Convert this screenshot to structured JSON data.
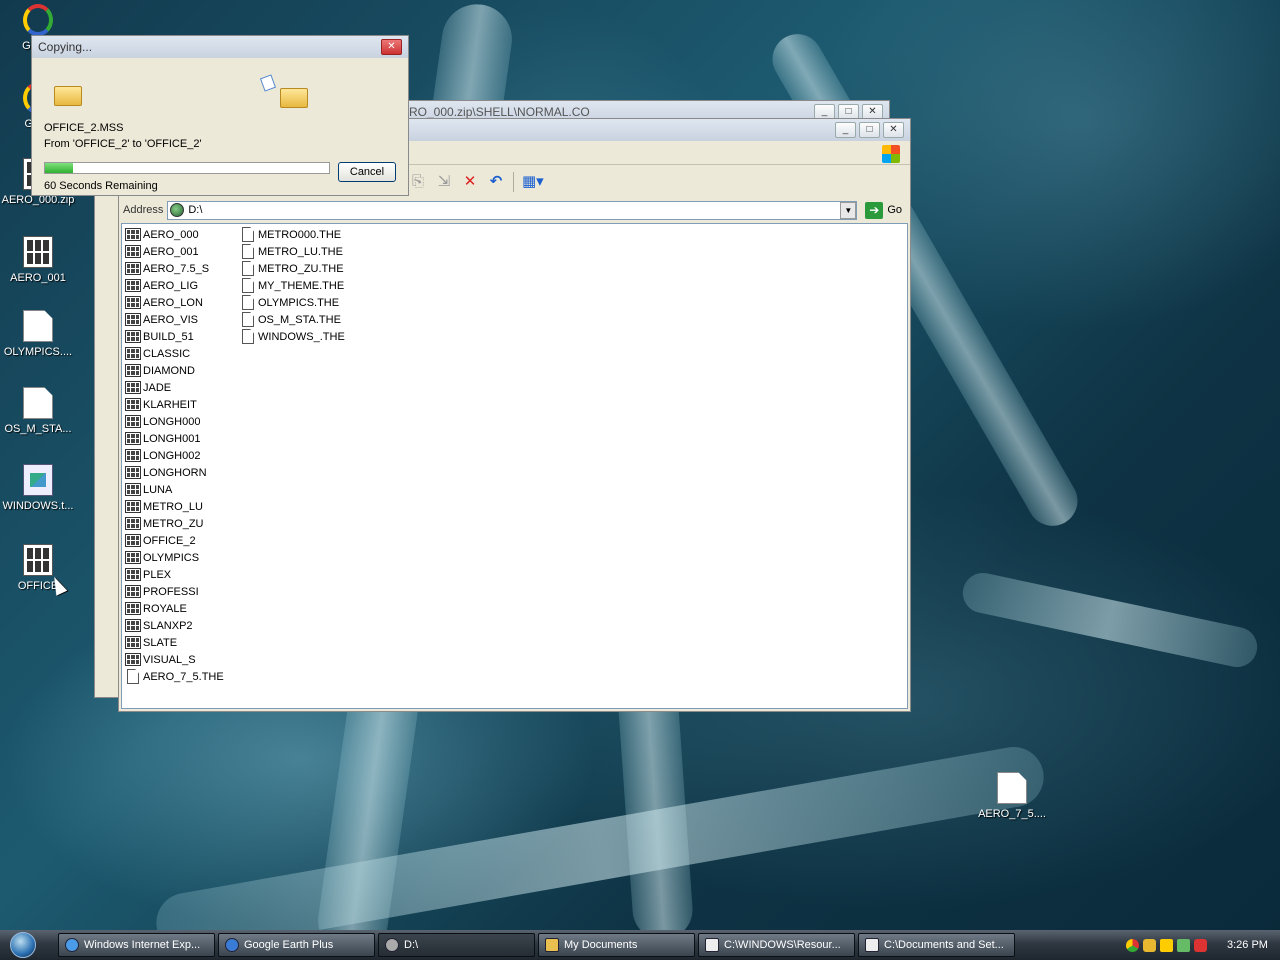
{
  "desktop": {
    "icons": [
      {
        "label": "Go De",
        "icon": "app-icon"
      },
      {
        "label": "Goog",
        "icon": "app-icon"
      },
      {
        "label": "AERO_000.zip",
        "icon": "zip-icon"
      },
      {
        "label": "AERO_001",
        "icon": "theme-grid-icon"
      },
      {
        "label": "OLYMPICS....",
        "icon": "document-icon"
      },
      {
        "label": "OS_M_STA...",
        "icon": "document-icon"
      },
      {
        "label": "WINDOWS.t...",
        "icon": "image-icon"
      },
      {
        "label": "OFFICE",
        "icon": "theme-grid-icon"
      },
      {
        "label": "AERO_7_5....",
        "icon": "document-icon"
      }
    ]
  },
  "back_window": {
    "title": "RO_000.zip\\SHELL\\NORMAL.CO"
  },
  "explorer": {
    "address_label": "Address",
    "address_value": "D:\\",
    "go_label": "Go",
    "column1": [
      "AERO_000",
      "AERO_001",
      "AERO_7.5_S",
      "AERO_LIG",
      "AERO_LON",
      "AERO_VIS",
      "BUILD_51",
      "CLASSIC",
      "DIAMOND",
      "JADE",
      "KLARHEIT",
      "LONGH000",
      "LONGH001",
      "LONGH002",
      "LONGHORN",
      "LUNA",
      "METRO_LU",
      "METRO_ZU",
      "OFFICE_2",
      "OLYMPICS",
      "PLEX",
      "PROFESSI",
      "ROYALE",
      "SLANXP2",
      "SLATE",
      "VISUAL_S",
      "AERO_7_5.THE"
    ],
    "column1_doc_index": 26,
    "column2": [
      "METRO000.THE",
      "METRO_LU.THE",
      "METRO_ZU.THE",
      "MY_THEME.THE",
      "OLYMPICS.THE",
      "OS_M_STA.THE",
      "WINDOWS_.THE"
    ]
  },
  "copy_dialog": {
    "title": "Copying...",
    "filename": "OFFICE_2.MSS",
    "from_to": "From 'OFFICE_2' to 'OFFICE_2'",
    "progress": 0.1,
    "remaining": "60 Seconds Remaining",
    "cancel_label": "Cancel"
  },
  "taskbar": {
    "buttons": [
      {
        "label": "Windows Internet Exp...",
        "icon": "ie-icon"
      },
      {
        "label": "Google Earth Plus",
        "icon": "globe-icon"
      },
      {
        "label": "D:\\",
        "icon": "drive-icon"
      },
      {
        "label": "My Documents",
        "icon": "folder-icon"
      },
      {
        "label": "C:\\WINDOWS\\Resour...",
        "icon": "grid-icon"
      },
      {
        "label": "C:\\Documents and Set...",
        "icon": "grid-icon"
      }
    ],
    "clock": "3:26 PM"
  },
  "colors": {
    "progress": "#2fb02f",
    "taskbar": "#2f3842"
  }
}
